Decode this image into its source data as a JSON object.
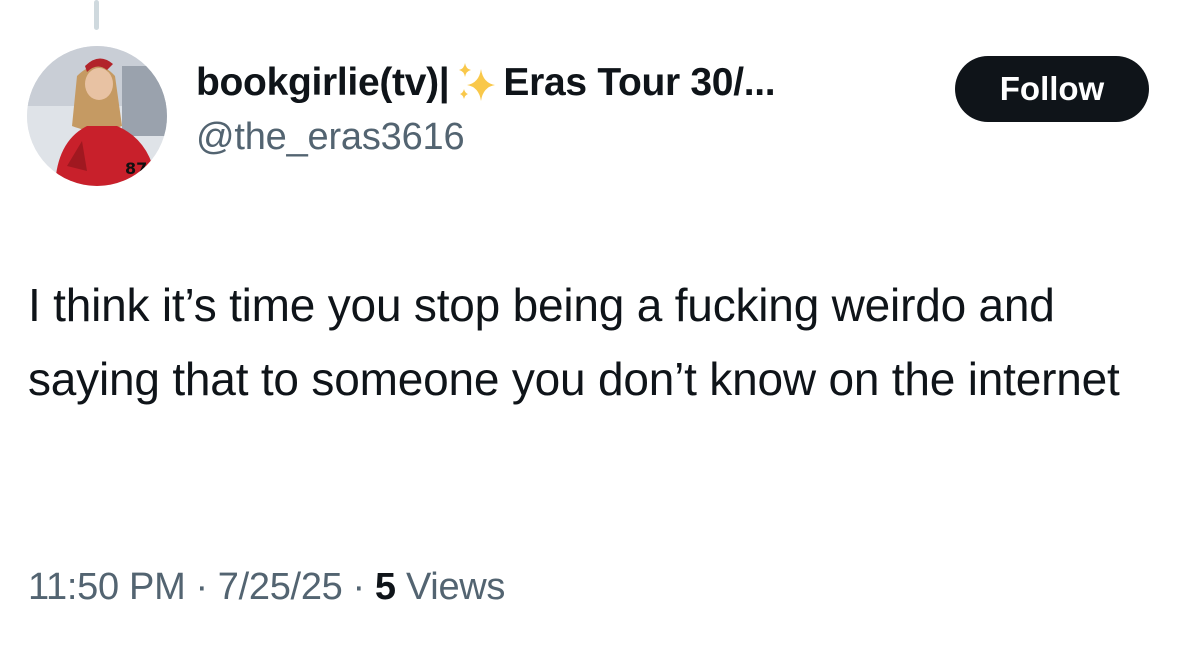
{
  "author": {
    "display_name_prefix": "bookgirlie(tv)|",
    "display_name_suffix": "Eras Tour 30/...",
    "handle": "@the_eras3616",
    "sparkle_icon_color": "#f9c84a"
  },
  "actions": {
    "follow_label": "Follow"
  },
  "tweet": {
    "text": "I think it’s time you stop being a fucking weirdo and saying that to someone you don’t know on the internet"
  },
  "meta": {
    "time": "11:50 PM",
    "separator": "·",
    "date": "7/25/25",
    "views_count": "5",
    "views_label": "Views"
  },
  "colors": {
    "text_primary": "#0f1419",
    "text_secondary": "#536471",
    "button_bg": "#0f1419"
  }
}
